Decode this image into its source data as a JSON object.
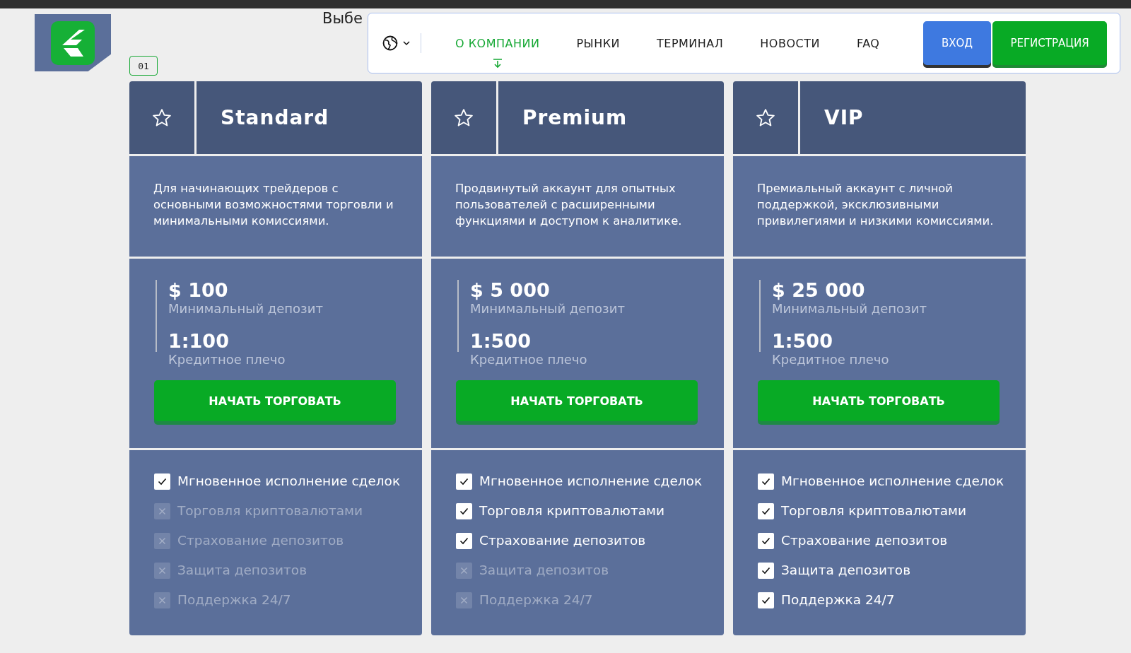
{
  "heading": "Выбе",
  "nav": {
    "links": [
      {
        "label": "О КОМПАНИИ",
        "selected": true
      },
      {
        "label": "РЫНКИ",
        "selected": false
      },
      {
        "label": "ТЕРМИНАЛ",
        "selected": false
      },
      {
        "label": "НОВОСТИ",
        "selected": false
      },
      {
        "label": "FAQ",
        "selected": false
      }
    ],
    "buttons": [
      {
        "label": "ВХОД",
        "kind": "login"
      },
      {
        "label": "РЕГИСТРАЦИЯ",
        "kind": "register"
      }
    ]
  },
  "step_badge": "01",
  "plans": [
    {
      "name": "Standard",
      "description": "Для начинающих трейдеров с основными возможностями торговли и минимальными комиссиями.",
      "deposit": "$ 100",
      "deposit_label": "Минимальный депозит",
      "leverage": "1:100",
      "leverage_label": "Кредитное плечо",
      "button": "НАЧАТЬ ТОРГОВАТЬ",
      "features": [
        {
          "label": "Мгновенное исполнение сделок",
          "checked": true
        },
        {
          "label": "Торговля криптовалютами",
          "checked": false
        },
        {
          "label": "Страхование депозитов",
          "checked": false
        },
        {
          "label": "Защита депозитов",
          "checked": false
        },
        {
          "label": "Поддержка 24/7",
          "checked": false
        }
      ]
    },
    {
      "name": "Premium",
      "description": "Продвинутый аккаунт для опытных пользователей с расширенными функциями и доступом к аналитике.",
      "deposit": "$ 5 000",
      "deposit_label": "Минимальный депозит",
      "leverage": "1:500",
      "leverage_label": "Кредитное плечо",
      "button": "НАЧАТЬ ТОРГОВАТЬ",
      "features": [
        {
          "label": "Мгновенное исполнение сделок",
          "checked": true
        },
        {
          "label": "Торговля криптовалютами",
          "checked": true
        },
        {
          "label": "Страхование депозитов",
          "checked": true
        },
        {
          "label": "Защита депозитов",
          "checked": false
        },
        {
          "label": "Поддержка 24/7",
          "checked": false
        }
      ]
    },
    {
      "name": "VIP",
      "description": "Премиальный аккаунт с личной поддержкой, эксклюзивными привилегиями и низкими комиссиями.",
      "deposit": "$ 25 000",
      "deposit_label": "Минимальный депозит",
      "leverage": "1:500",
      "leverage_label": "Кредитное плечо",
      "button": "НАЧАТЬ ТОРГОВАТЬ",
      "features": [
        {
          "label": "Мгновенное исполнение сделок",
          "checked": true
        },
        {
          "label": "Торговля криптовалютами",
          "checked": true
        },
        {
          "label": "Страхование депозитов",
          "checked": true
        },
        {
          "label": "Защита депозитов",
          "checked": true
        },
        {
          "label": "Поддержка 24/7",
          "checked": true
        }
      ]
    }
  ]
}
